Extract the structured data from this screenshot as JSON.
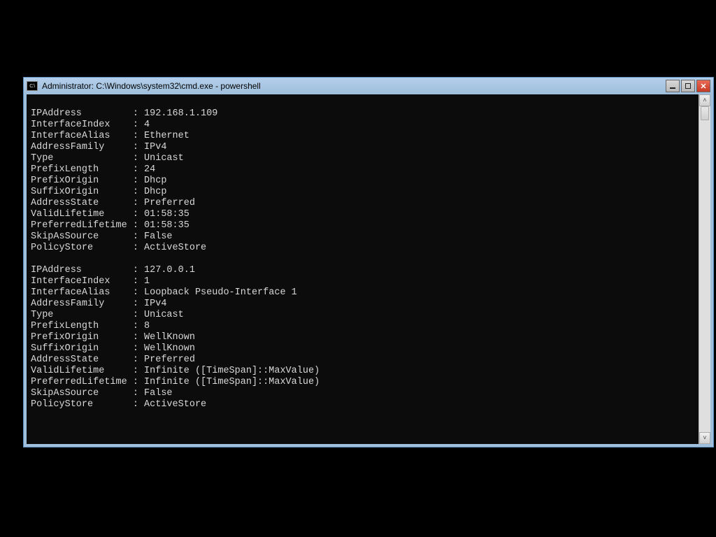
{
  "window": {
    "icon_text": "C:\\",
    "title": "Administrator: C:\\Windows\\system32\\cmd.exe - powershell"
  },
  "output": {
    "blocks": [
      {
        "IPAddress": "192.168.1.109",
        "InterfaceIndex": "4",
        "InterfaceAlias": "Ethernet",
        "AddressFamily": "IPv4",
        "Type": "Unicast",
        "PrefixLength": "24",
        "PrefixOrigin": "Dhcp",
        "SuffixOrigin": "Dhcp",
        "AddressState": "Preferred",
        "ValidLifetime": "01:58:35",
        "PreferredLifetime": "01:58:35",
        "SkipAsSource": "False",
        "PolicyStore": "ActiveStore"
      },
      {
        "IPAddress": "127.0.0.1",
        "InterfaceIndex": "1",
        "InterfaceAlias": "Loopback Pseudo-Interface 1",
        "AddressFamily": "IPv4",
        "Type": "Unicast",
        "PrefixLength": "8",
        "PrefixOrigin": "WellKnown",
        "SuffixOrigin": "WellKnown",
        "AddressState": "Preferred",
        "ValidLifetime": "Infinite ([TimeSpan]::MaxValue)",
        "PreferredLifetime": "Infinite ([TimeSpan]::MaxValue)",
        "SkipAsSource": "False",
        "PolicyStore": "ActiveStore"
      }
    ],
    "field_order": [
      "IPAddress",
      "InterfaceIndex",
      "InterfaceAlias",
      "AddressFamily",
      "Type",
      "PrefixLength",
      "PrefixOrigin",
      "SuffixOrigin",
      "AddressState",
      "ValidLifetime",
      "PreferredLifetime",
      "SkipAsSource",
      "PolicyStore"
    ]
  }
}
